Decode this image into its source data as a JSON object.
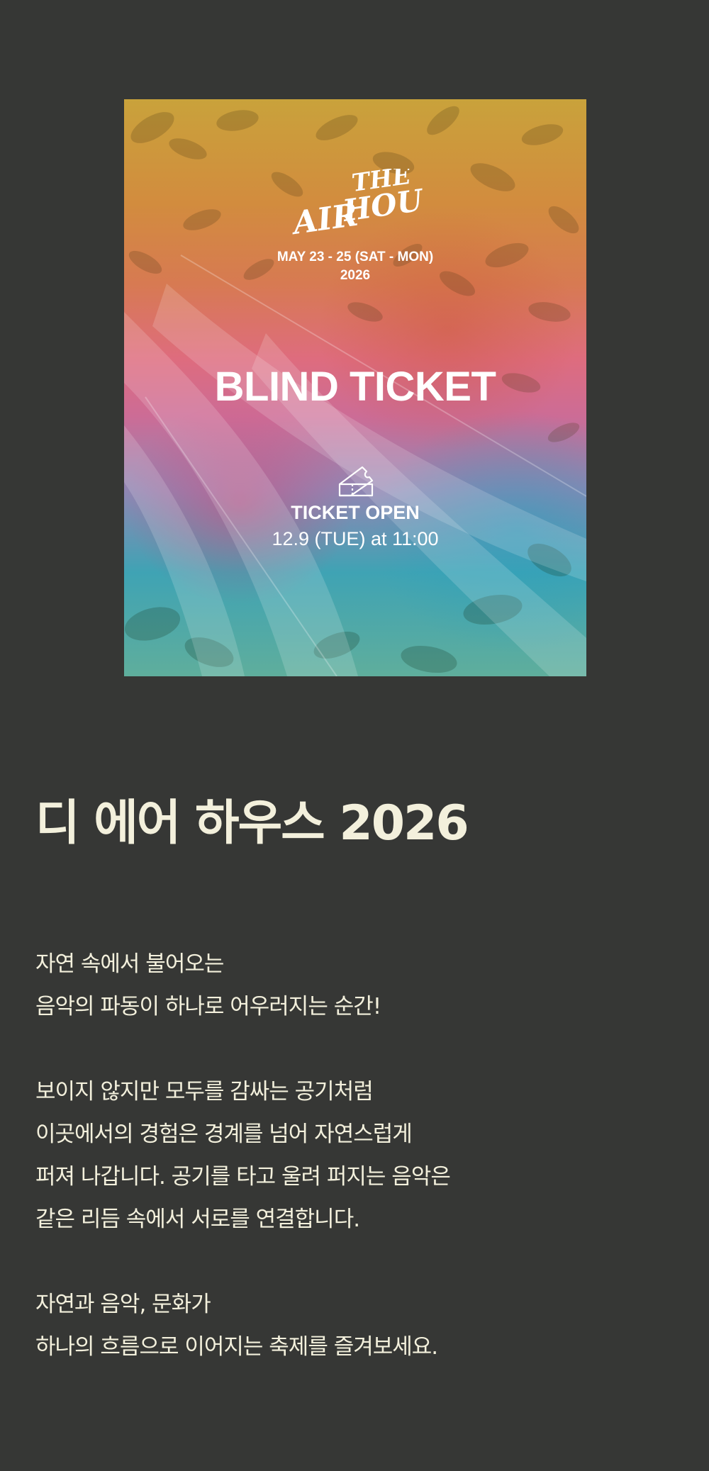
{
  "poster": {
    "logo_line1": "THE",
    "logo_line2": "AIR",
    "logo_line3": "HOUSE",
    "dates_line1": "MAY 23 - 25 (SAT - MON)",
    "dates_line2": "2026",
    "blind_title": "BLIND TICKET",
    "ticket_open_label": "TICKET OPEN",
    "ticket_open_date": "12.9 (TUE) at 11:00",
    "icon": "ticket-icon"
  },
  "page_title": "디 에어 하우스 2026",
  "description": {
    "paragraph1": [
      "자연 속에서 불어오는",
      "음악의 파동이 하나로 어우러지는 순간!"
    ],
    "paragraph2": [
      "보이지 않지만 모두를 감싸는 공기처럼",
      "이곳에서의 경험은 경계를 넘어 자연스럽게",
      "퍼져 나갑니다. 공기를 타고 울려 퍼지는 음악은",
      "같은 리듬 속에서 서로를 연결합니다."
    ],
    "paragraph3": [
      "자연과 음악, 문화가",
      "하나의 흐름으로 이어지는 축제를 즐겨보세요."
    ]
  },
  "colors": {
    "background": "#363735",
    "text": "#f3f0dc"
  }
}
